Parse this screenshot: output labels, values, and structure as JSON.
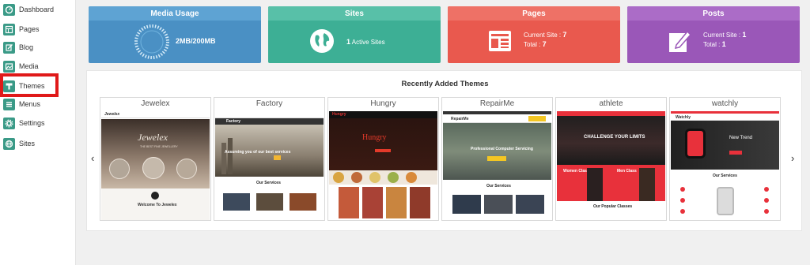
{
  "sidebar": {
    "items": [
      {
        "label": "Dashboard",
        "icon": "dashboard-icon"
      },
      {
        "label": "Pages",
        "icon": "pages-icon"
      },
      {
        "label": "Blog",
        "icon": "blog-icon"
      },
      {
        "label": "Media",
        "icon": "media-icon"
      },
      {
        "label": "Themes",
        "icon": "themes-icon",
        "active": true
      },
      {
        "label": "Menus",
        "icon": "menus-icon"
      },
      {
        "label": "Settings",
        "icon": "settings-icon"
      },
      {
        "label": "Sites",
        "icon": "sites-icon"
      }
    ],
    "highlight_color": "#e01919"
  },
  "cards": {
    "media": {
      "title": "Media Usage",
      "value": "2MB/200MB",
      "color": "#4a90c4",
      "head_color": "#5ea3d3"
    },
    "sites": {
      "title": "Sites",
      "count": "1",
      "label": "Active Sites",
      "color": "#3daf95",
      "head_color": "#58c0a8"
    },
    "pages": {
      "title": "Pages",
      "current_label": "Current Site :",
      "current": "7",
      "total_label": "Total :",
      "total": "7",
      "color": "#e9594e",
      "head_color": "#ee7166"
    },
    "posts": {
      "title": "Posts",
      "current_label": "Current Site :",
      "current": "1",
      "total_label": "Total :",
      "total": "1",
      "color": "#9a57b8",
      "head_color": "#ab6cc7"
    }
  },
  "themes": {
    "title": "Recently Added Themes",
    "prev_icon": "chevron-left-icon",
    "next_icon": "chevron-right-icon",
    "prev": "‹",
    "next": "›",
    "items": [
      {
        "name": "Jewelex",
        "logo": "Jewelex",
        "hero": "Jewelex",
        "tagline": "THE BEST FINE JEWELLERY",
        "section": "Welcome To Jewelex"
      },
      {
        "name": "Factory",
        "logo": "Factory",
        "hero": "Assureing you of our best services",
        "section": "Our Services"
      },
      {
        "name": "Hungry",
        "logo": "Hungry",
        "hero": "Hungry"
      },
      {
        "name": "RepairMe",
        "logo": "RepairMe",
        "hero": "Professional Computer Servicing",
        "section": "Our Services"
      },
      {
        "name": "athlete",
        "hero": "CHALLENGE YOUR LIMITS",
        "class_a": "Women Class",
        "class_b": "Men Class",
        "section": "Our Popular Classes"
      },
      {
        "name": "watchly",
        "logo": "Watchly",
        "hero": "New Trend",
        "section": "Our Services"
      }
    ]
  }
}
